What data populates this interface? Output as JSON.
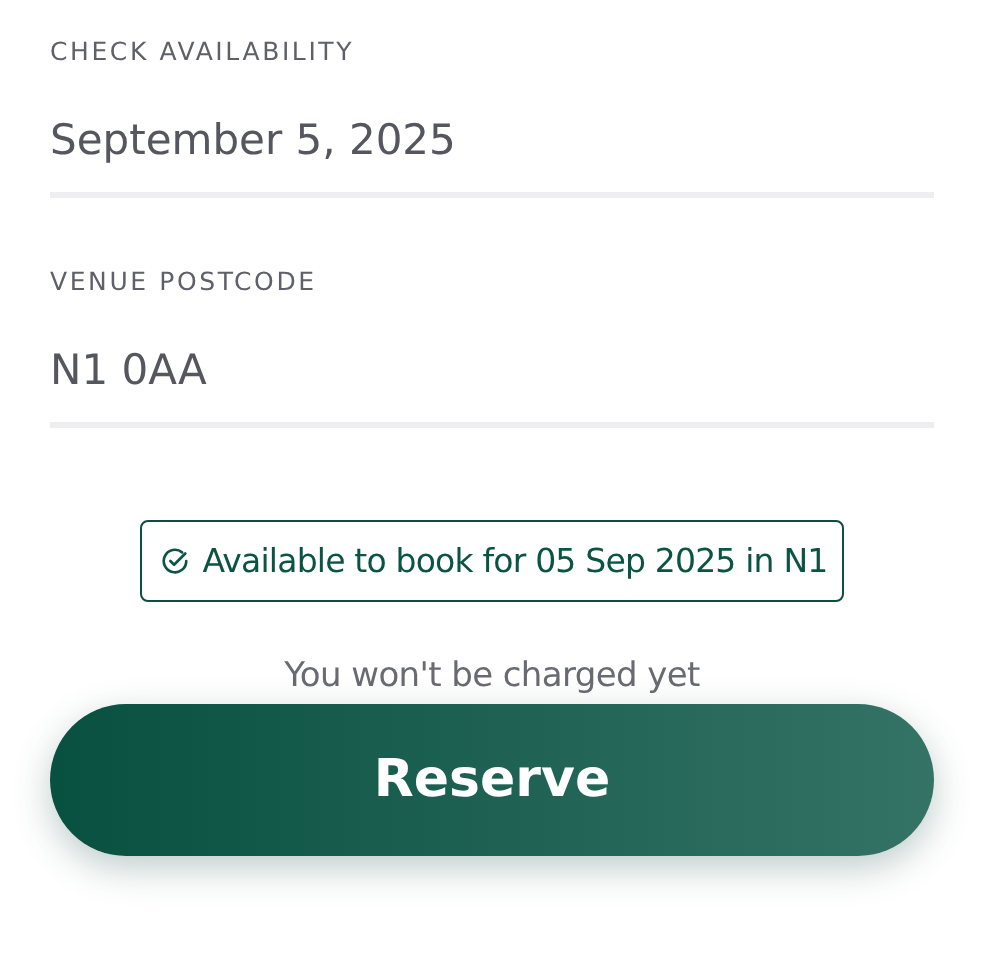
{
  "fields": [
    {
      "label": "CHECK AVAILABILITY",
      "value": "September 5, 2025"
    },
    {
      "label": "VENUE POSTCODE",
      "value": "N1 0AA"
    }
  ],
  "availability": {
    "available": true,
    "message": "Available to book for 05 Sep 2025 in N1"
  },
  "note": "You won't be charged yet",
  "button": {
    "label": "Reserve"
  }
}
